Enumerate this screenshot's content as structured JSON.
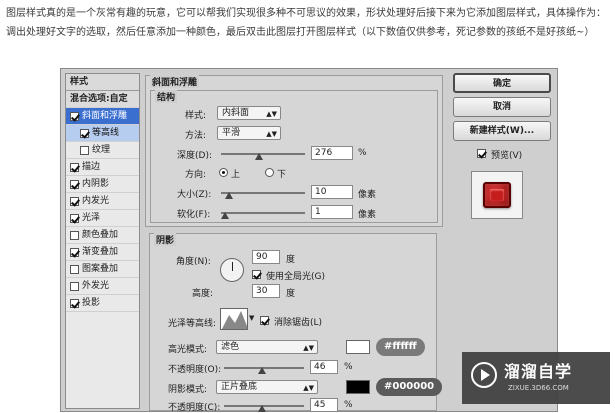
{
  "intro": "图层样式真的是一个灰常有趣的玩意，它可以帮我们实现很多种不可思议的效果，形状处理好后接下来为它添加图层样式，具体操作为：调出处理好文字的选取，然后任意添加一种颜色，最后双击此图层打开图层样式（以下数值仅供参考，死记参数的孩纸不是好孩纸~）",
  "styles_panel": {
    "header": "样式",
    "blend_options": "混合选项:自定",
    "items": [
      {
        "label": "斜面和浮雕",
        "checked": true,
        "selected": true,
        "sub": false
      },
      {
        "label": "等高线",
        "checked": true,
        "selected": true,
        "sub": true
      },
      {
        "label": "纹理",
        "checked": false,
        "selected": false,
        "sub": true
      },
      {
        "label": "描边",
        "checked": true,
        "selected": false,
        "sub": false
      },
      {
        "label": "内阴影",
        "checked": true,
        "selected": false,
        "sub": false
      },
      {
        "label": "内发光",
        "checked": true,
        "selected": false,
        "sub": false
      },
      {
        "label": "光泽",
        "checked": true,
        "selected": false,
        "sub": false
      },
      {
        "label": "颜色叠加",
        "checked": false,
        "selected": false,
        "sub": false
      },
      {
        "label": "渐变叠加",
        "checked": true,
        "selected": false,
        "sub": false
      },
      {
        "label": "图案叠加",
        "checked": false,
        "selected": false,
        "sub": false
      },
      {
        "label": "外发光",
        "checked": false,
        "selected": false,
        "sub": false
      },
      {
        "label": "投影",
        "checked": true,
        "selected": false,
        "sub": false
      }
    ]
  },
  "bevel": {
    "title": "斜面和浮雕",
    "structure_title": "结构",
    "style_label": "样式:",
    "style_value": "内斜面",
    "technique_label": "方法:",
    "technique_value": "平滑",
    "depth_label": "深度(D):",
    "depth_value": "276",
    "depth_unit": "%",
    "direction_label": "方向:",
    "direction_up": "上",
    "direction_down": "下",
    "size_label": "大小(Z):",
    "size_value": "10",
    "size_unit": "像素",
    "soften_label": "软化(F):",
    "soften_value": "1",
    "soften_unit": "像素"
  },
  "shading": {
    "title": "阴影",
    "angle_label": "角度(N):",
    "angle_value": "90",
    "angle_unit": "度",
    "global_light_label": "使用全局光(G)",
    "altitude_label": "高度:",
    "altitude_value": "30",
    "altitude_unit": "度",
    "gloss_label": "光泽等高线:",
    "antialias_label": "消除锯齿(L)",
    "highlight_label": "高光模式:",
    "highlight_mode": "滤色",
    "highlight_color": "#ffffff",
    "highlight_opacity_label": "不透明度(O):",
    "highlight_opacity": "46",
    "shadow_label": "阴影模式:",
    "shadow_mode": "正片叠底",
    "shadow_color": "#000000",
    "shadow_opacity_label": "不透明度(C):",
    "shadow_opacity": "45",
    "percent": "%"
  },
  "buttons": {
    "ok": "确定",
    "cancel": "取消",
    "new_style": "新建样式(W)...",
    "preview": "预览(V)"
  },
  "annotations": {
    "highlight_hex": "#ffffff",
    "shadow_hex": "#000000"
  },
  "watermark": {
    "title": "溜溜自学",
    "url": "ZIXUE.3D66.COM"
  }
}
